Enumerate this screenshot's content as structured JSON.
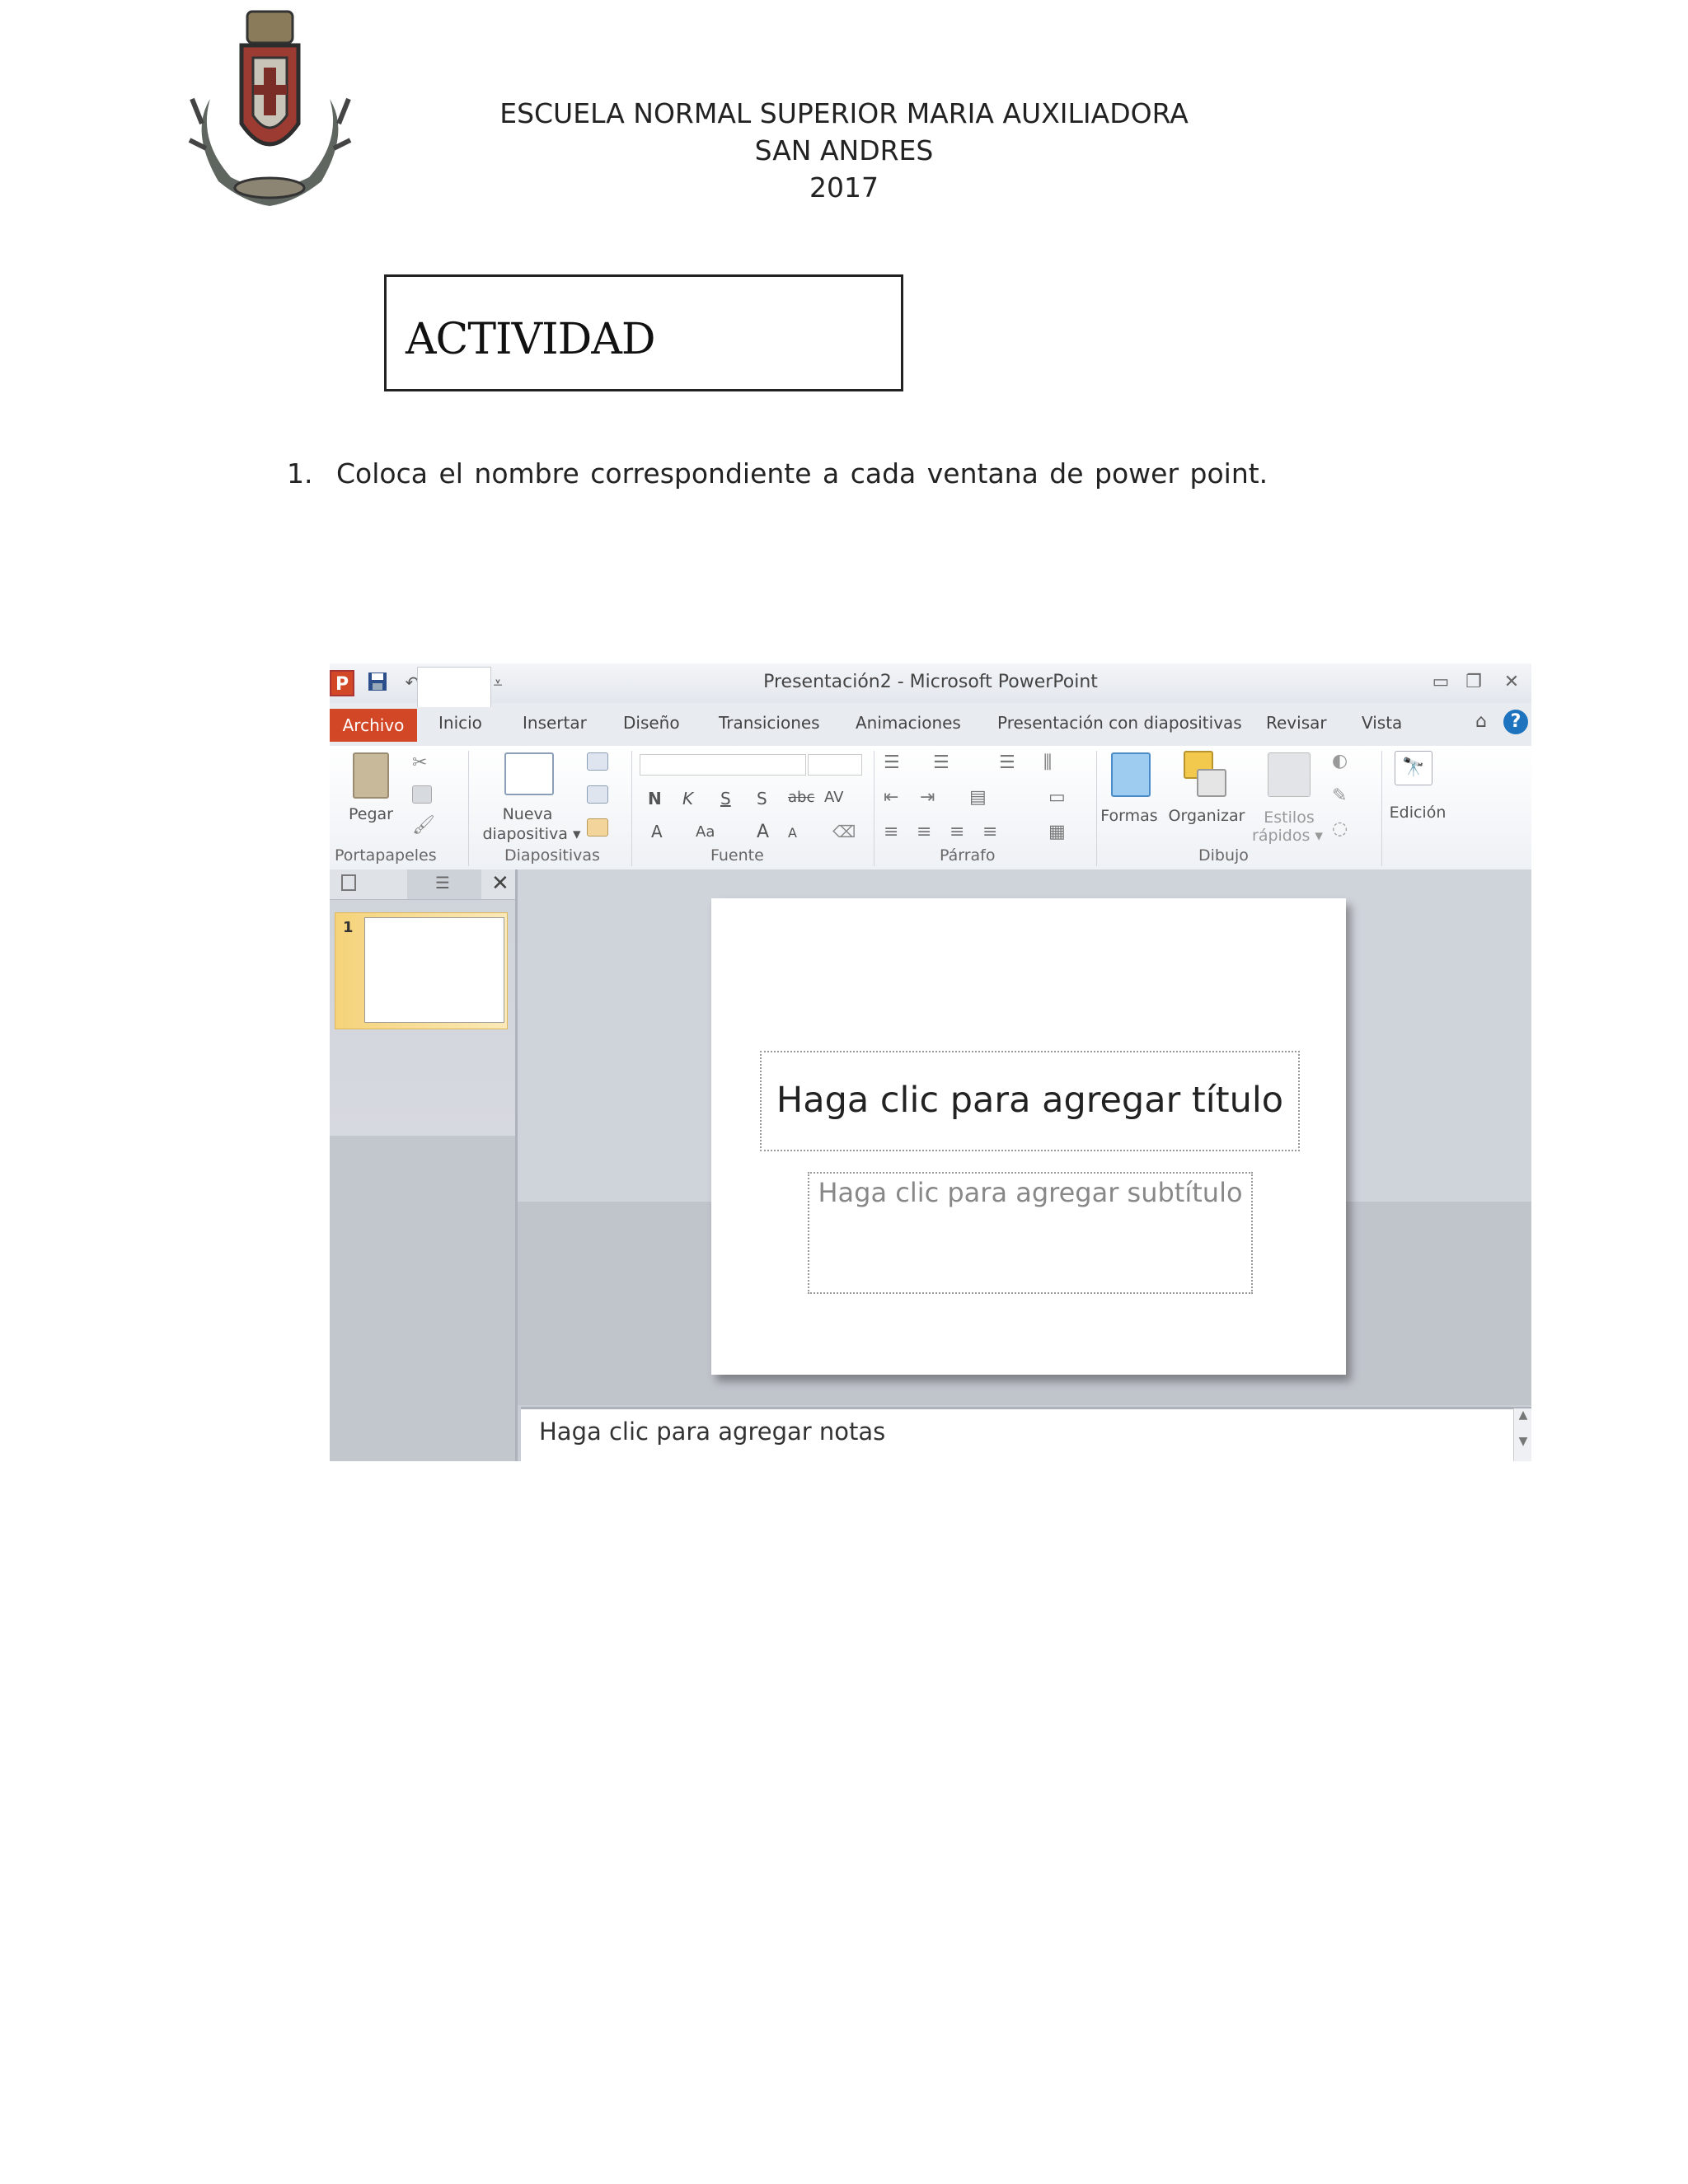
{
  "header": {
    "school": "ESCUELA NORMAL SUPERIOR MARIA AUXILIADORA",
    "town": "SAN ANDRES",
    "year": "2017"
  },
  "activity": {
    "label": "ACTIVIDAD"
  },
  "question": {
    "number": "1.",
    "text": "Coloca el nombre  correspondiente  a cada  ventana de power  point."
  },
  "ppt": {
    "window_title": "Presentación2  -  Microsoft PowerPoint",
    "app_icon": "P",
    "tabs": [
      "Archivo",
      "Inicio",
      "Insertar",
      "Diseño",
      "Transiciones",
      "Animaciones",
      "Presentación con diapositivas",
      "Revisar",
      "Vista"
    ],
    "groups": [
      "Portapapeles",
      "Diapositivas",
      "Fuente",
      "Párrafo",
      "Dibujo"
    ],
    "buttons": {
      "pegar": "Pegar",
      "nueva_1": "Nueva",
      "nueva_2": "diapositiva ▾",
      "formas": "Formas",
      "organizar": "Organizar",
      "estilos_1": "Estilos",
      "estilos_2": "rápidos ▾",
      "edicion": "Edición"
    },
    "font_buttons": [
      "N",
      "K",
      "S",
      "S",
      "abc",
      "AV"
    ],
    "thumbnail_number": "1",
    "slide_title_placeholder": "Haga clic para agregar título",
    "slide_subtitle_placeholder": "Haga clic para agregar subtítulo",
    "notes_placeholder": "Haga clic para agregar notas",
    "colors": {
      "accent": "#d24726",
      "help": "#1e73be"
    }
  }
}
